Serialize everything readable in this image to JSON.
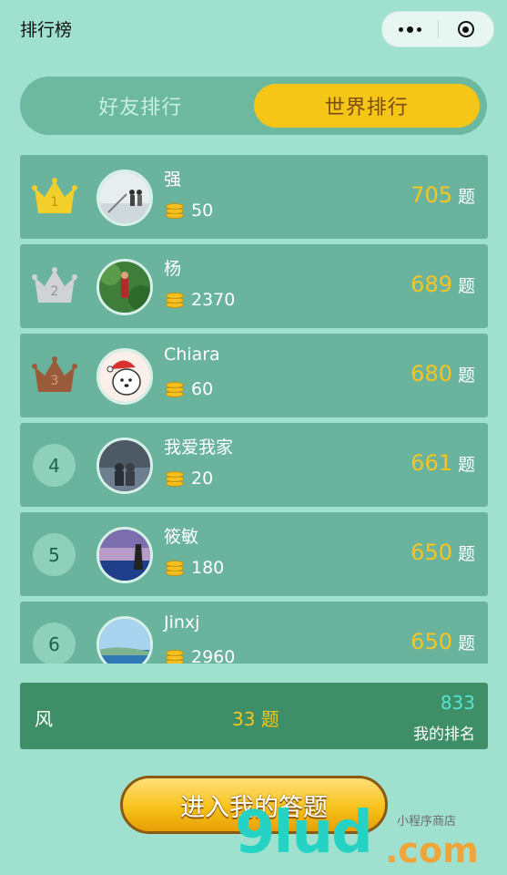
{
  "window": {
    "title": "排行榜"
  },
  "tabs": [
    {
      "label": "好友排行",
      "active": false
    },
    {
      "label": "世界排行",
      "active": true
    }
  ],
  "rankings": [
    {
      "rank": "1",
      "name": "强",
      "coins": "50",
      "score": "705",
      "unit": "题",
      "badge": "gold-crown"
    },
    {
      "rank": "2",
      "name": "杨",
      "coins": "2370",
      "score": "689",
      "unit": "题",
      "badge": "silver-crown"
    },
    {
      "rank": "3",
      "name": "Chiara",
      "coins": "60",
      "score": "680",
      "unit": "题",
      "badge": "bronze-crown"
    },
    {
      "rank": "4",
      "name": "我爱我家",
      "coins": "20",
      "score": "661",
      "unit": "题",
      "badge": "circle"
    },
    {
      "rank": "5",
      "name": "筱敏",
      "coins": "180",
      "score": "650",
      "unit": "题",
      "badge": "circle"
    },
    {
      "rank": "6",
      "name": "Jinxj",
      "coins": "2960",
      "score": "650",
      "unit": "题",
      "badge": "circle"
    }
  ],
  "my_rank": {
    "name": "风",
    "score": "33 题",
    "rank": "833",
    "label": "我的排名"
  },
  "cta": {
    "label": "进入我的答题"
  },
  "watermark": {
    "main": "9lud",
    "suffix": ".com",
    "sub": "小程序商店"
  },
  "colors": {
    "background": "#9fe0cf",
    "row": "#6ab39d",
    "score_accent": "#f6c522",
    "active_tab": "#f5c518",
    "my_bar": "#3e8f68"
  }
}
